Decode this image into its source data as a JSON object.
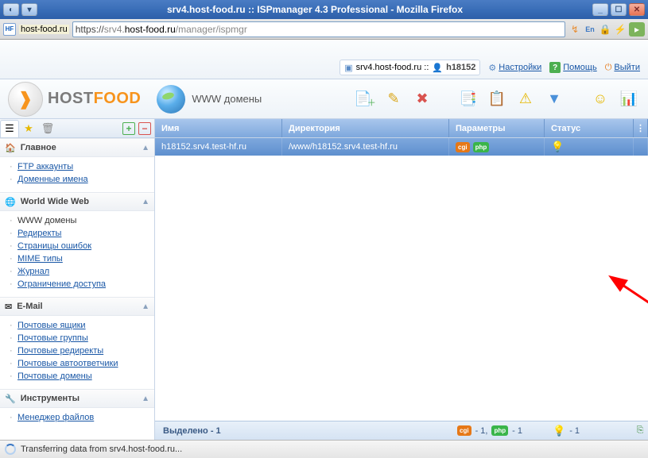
{
  "window": {
    "title": "srv4.host-food.ru :: ISPmanager 4.3 Professional - Mozilla Firefox"
  },
  "url": {
    "domain_label": "host-food.ru",
    "protocol": "https://",
    "host_grey": "srv4.",
    "host": "host-food.ru",
    "path": "/manager/ispmgr",
    "favicon": "HF"
  },
  "header": {
    "breadcrumb_host": "srv4.host-food.ru ::",
    "user": "h18152",
    "settings": "Настройки",
    "help": "Помощь",
    "logout": "Выйти"
  },
  "brand": {
    "name_host": "HOST",
    "name_food": "FOOD",
    "section": "WWW домены"
  },
  "table": {
    "columns": {
      "name": "Имя",
      "dir": "Директория",
      "params": "Параметры",
      "status": "Статус"
    },
    "rows": [
      {
        "name": "h18152.srv4.test-hf.ru",
        "dir": "/www/h18152.srv4.test-hf.ru",
        "badges": [
          "cgi",
          "php"
        ],
        "status": "on"
      }
    ],
    "footer": {
      "selected": "Выделено - 1",
      "cgi_count": "- 1,",
      "php_count": "- 1",
      "status_count": "- 1"
    }
  },
  "sidebar": {
    "groups": [
      {
        "icon": "home",
        "title": "Главное",
        "items": [
          "FTP аккаунты",
          "Доменные имена"
        ]
      },
      {
        "icon": "globe",
        "title": "World Wide Web",
        "items": [
          "WWW домены",
          "Редиректы",
          "Страницы ошибок",
          "MIME типы",
          "Журнал",
          "Ограничение доступа"
        ],
        "active": 0
      },
      {
        "icon": "mail",
        "title": "E-Mail",
        "items": [
          "Почтовые ящики",
          "Почтовые группы",
          "Почтовые редиректы",
          "Почтовые автоответчики",
          "Почтовые домены"
        ]
      },
      {
        "icon": "tools",
        "title": "Инструменты",
        "items": [
          "Менеджер файлов"
        ]
      }
    ]
  },
  "status": {
    "text": "Transferring data from srv4.host-food.ru..."
  }
}
